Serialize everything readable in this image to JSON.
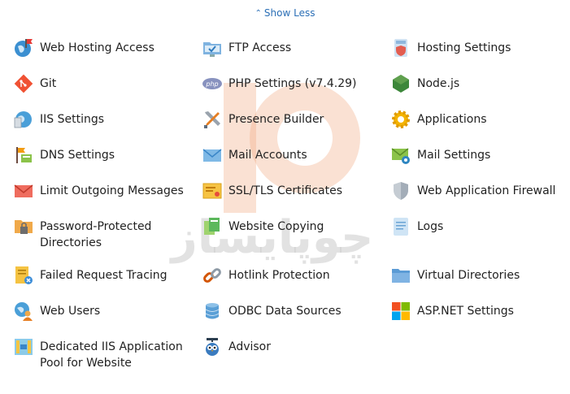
{
  "show_less": "Show Less",
  "items": [
    {
      "label": "Web Hosting Access",
      "icon": "globe-flag-icon"
    },
    {
      "label": "FTP Access",
      "icon": "ftp-folder-icon"
    },
    {
      "label": "Hosting Settings",
      "icon": "hosting-settings-icon"
    },
    {
      "label": "Git",
      "icon": "git-icon"
    },
    {
      "label": "PHP Settings (v7.4.29)",
      "icon": "php-icon"
    },
    {
      "label": "Node.js",
      "icon": "nodejs-icon"
    },
    {
      "label": "IIS Settings",
      "icon": "iis-icon"
    },
    {
      "label": "Presence Builder",
      "icon": "tools-icon"
    },
    {
      "label": "Applications",
      "icon": "gear-icon"
    },
    {
      "label": "DNS Settings",
      "icon": "dns-icon"
    },
    {
      "label": "Mail Accounts",
      "icon": "envelope-icon"
    },
    {
      "label": "Mail Settings",
      "icon": "mail-settings-icon"
    },
    {
      "label": "Limit Outgoing Messages",
      "icon": "limit-mail-icon"
    },
    {
      "label": "SSL/TLS Certificates",
      "icon": "certificate-icon"
    },
    {
      "label": "Web Application Firewall",
      "icon": "shield-icon"
    },
    {
      "label": "Password-Protected Directories",
      "icon": "locked-folder-icon"
    },
    {
      "label": "Website Copying",
      "icon": "copy-icon"
    },
    {
      "label": "Logs",
      "icon": "log-icon"
    },
    {
      "label": "Failed Request Tracing",
      "icon": "trace-icon"
    },
    {
      "label": "Hotlink Protection",
      "icon": "link-icon"
    },
    {
      "label": "Virtual Directories",
      "icon": "folder-icon"
    },
    {
      "label": "Web Users",
      "icon": "web-users-icon"
    },
    {
      "label": "ODBC Data Sources",
      "icon": "database-icon"
    },
    {
      "label": "ASP.NET Settings",
      "icon": "aspnet-icon"
    },
    {
      "label": "Dedicated IIS Application Pool for Website",
      "icon": "app-pool-icon"
    },
    {
      "label": "Advisor",
      "icon": "owl-icon"
    }
  ],
  "watermark_text": "چوپایساز"
}
